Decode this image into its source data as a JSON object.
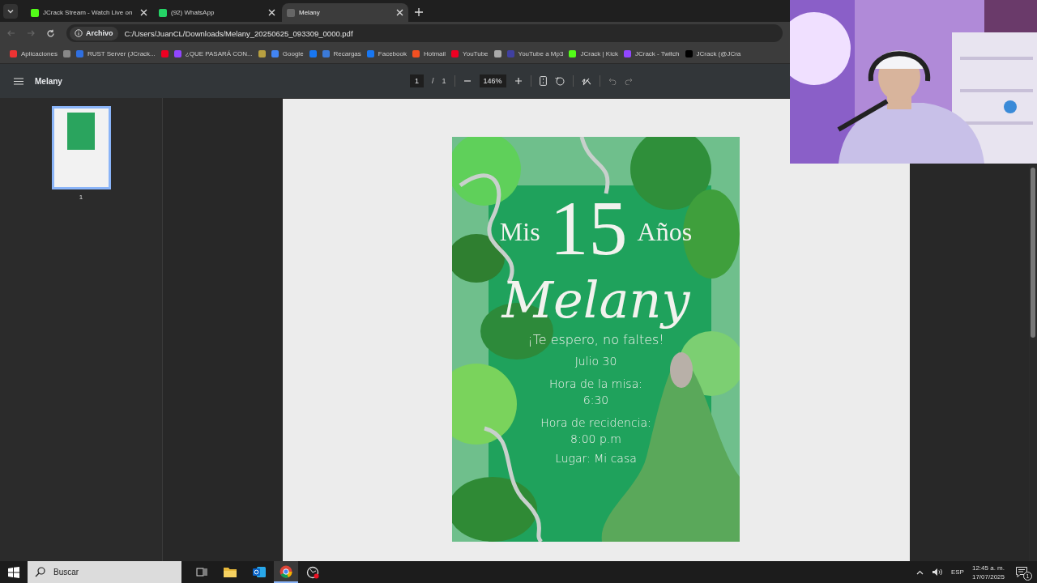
{
  "tabs": [
    {
      "title": "JCrack Stream - Watch Live on",
      "selected": false
    },
    {
      "title": "(92) WhatsApp",
      "selected": false
    },
    {
      "title": "Melany",
      "selected": true
    }
  ],
  "address_bar": {
    "chip": "Archivo",
    "url": "C:/Users/JuanCL/Downloads/Melany_20250625_093309_0000.pdf"
  },
  "bookmarks": [
    {
      "kind": "link",
      "label": "Aplicaciones"
    },
    {
      "kind": "icon"
    },
    {
      "kind": "link",
      "label": "RUST Server (JCrack..."
    },
    {
      "kind": "icon"
    },
    {
      "kind": "link",
      "label": "¿QUE PASARÁ CON..."
    },
    {
      "kind": "icon"
    },
    {
      "kind": "link",
      "label": "Google"
    },
    {
      "kind": "icon"
    },
    {
      "kind": "link",
      "label": "Recargas"
    },
    {
      "kind": "link",
      "label": "Facebook"
    },
    {
      "kind": "link",
      "label": "Hotmail"
    },
    {
      "kind": "link",
      "label": "YouTube"
    },
    {
      "kind": "icon"
    },
    {
      "kind": "link",
      "label": "YouTube a Mp3"
    },
    {
      "kind": "link",
      "label": "JCrack | Kick"
    },
    {
      "kind": "link",
      "label": "JCrack - Twitch"
    },
    {
      "kind": "link",
      "label": "JCrack (@JCra"
    }
  ],
  "pdf_toolbar": {
    "title": "Melany",
    "page": "1",
    "separator": "/",
    "pages": "1",
    "zoom": "146%"
  },
  "thumbnails": [
    {
      "number": "1",
      "selected": true
    }
  ],
  "invitation": {
    "mis": "Mis",
    "number": "15",
    "anos": "Años",
    "name": "Melany",
    "lines": [
      "¡Te espero, no faltes!",
      "Julio 30",
      "Hora de la misa:",
      "6:30",
      "Hora de recidencia:",
      "8:00 p.m",
      "Lugar: Mi casa"
    ]
  },
  "taskbar": {
    "search_placeholder": "Buscar",
    "language": "ESP",
    "time": "12:45 a. m.",
    "date": "17/07/2025",
    "notifications": "1"
  }
}
